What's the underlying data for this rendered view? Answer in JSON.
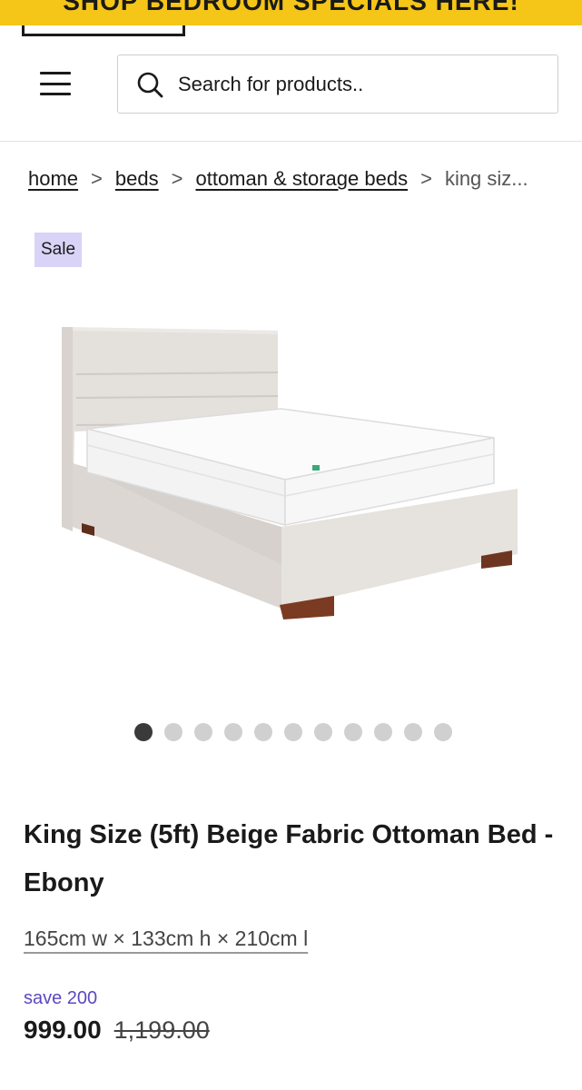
{
  "promo": {
    "text": "SHOP BEDROOM SPECIALS HERE!"
  },
  "header": {
    "menu_icon": "hamburger-menu-icon",
    "search": {
      "icon": "search-icon",
      "placeholder": "Search for products.."
    }
  },
  "breadcrumb": {
    "items": [
      "home",
      "beds",
      "ottoman & storage beds"
    ],
    "separator": ">",
    "current": "king siz..."
  },
  "product": {
    "badge": "Sale",
    "image_alt": "Beige fabric ottoman bed with mattress",
    "carousel": {
      "count": 11,
      "active_index": 0
    },
    "title": "King Size (5ft) Beige Fabric Ottoman Bed - Ebony",
    "dimensions": "165cm w × 133cm h × 210cm l",
    "save_text": "save 200",
    "price": "999.00",
    "old_price": "1,199.00"
  },
  "colors": {
    "promo": "#f5c518",
    "sale_badge": "#d9d3f7",
    "save_text": "#5b48c4"
  }
}
